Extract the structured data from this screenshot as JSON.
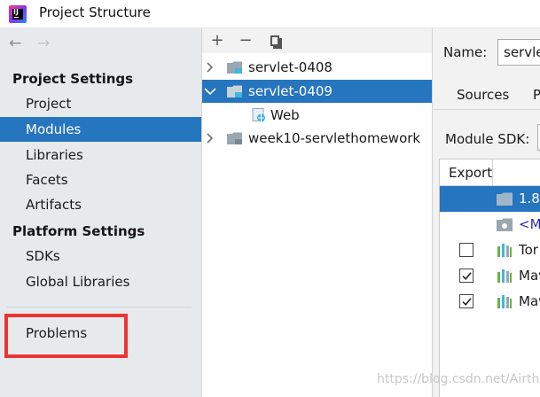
{
  "window": {
    "title": "Project Structure"
  },
  "sidebar": {
    "sections": [
      {
        "title": "Project Settings",
        "items": [
          "Project",
          "Modules",
          "Libraries",
          "Facets",
          "Artifacts"
        ]
      },
      {
        "title": "Platform Settings",
        "items": [
          "SDKs",
          "Global Libraries"
        ]
      }
    ],
    "selected": "Modules",
    "problems": "Problems"
  },
  "tree": {
    "toolbar": {
      "add": "+",
      "remove": "−"
    },
    "items": [
      {
        "label": "servlet-0408",
        "expanded": false
      },
      {
        "label": "servlet-0409",
        "expanded": true,
        "selected": true,
        "children": [
          {
            "label": "Web"
          }
        ]
      },
      {
        "label": "week10-servlethomework",
        "expanded": false
      }
    ]
  },
  "details": {
    "name_label": "Name:",
    "name_value": "servle",
    "tabs": [
      "Sources",
      "P"
    ],
    "module_sdk_label": "Module SDK:",
    "table": {
      "header": "Export",
      "rows": [
        {
          "label": "1.8",
          "checkbox": null,
          "selected": true,
          "icon": "folder-icon"
        },
        {
          "label": "<M",
          "checkbox": null,
          "icon": "module-source-folder-icon"
        },
        {
          "label": "Tor",
          "checkbox": false,
          "icon": "library-icon"
        },
        {
          "label": "Mav",
          "checkbox": true,
          "icon": "library-icon"
        },
        {
          "label": "Mav",
          "checkbox": true,
          "icon": "library-icon"
        }
      ]
    }
  },
  "watermark": "https://blog.csdn.net/Airth",
  "colors": {
    "selection": "#2675bf",
    "highlight_box": "#ee3333",
    "sidebar_bg": "#e7eaed"
  }
}
